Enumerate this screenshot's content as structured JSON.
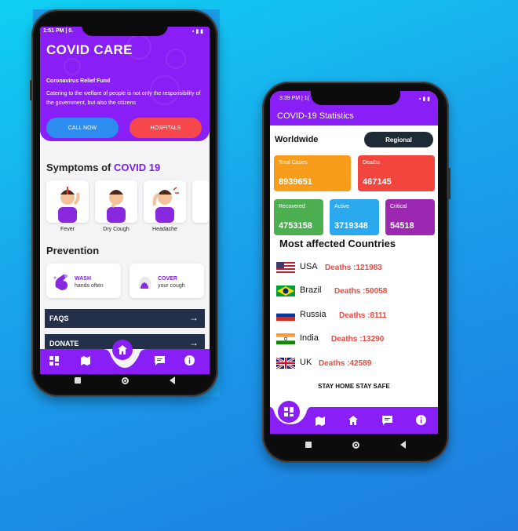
{
  "left_phone": {
    "status": {
      "time": "1:51 PM | 0."
    },
    "hero": {
      "title": "COVID CARE",
      "subtitle": "Coronavirus Relief Fund",
      "description": "Catering to the welfare of people is not only the responsibility of the government, but also the citizens"
    },
    "buttons": {
      "call": "CALL NOW",
      "hospitals": "HOSPITALS"
    },
    "symptoms": {
      "title_prefix": "Symptoms of ",
      "title_accent": "COVID 19",
      "items": [
        "Fever",
        "Dry Cough",
        "Headache"
      ]
    },
    "prevention": {
      "title": "Prevention",
      "items": [
        {
          "action": "WASH",
          "detail": "hands often"
        },
        {
          "action": "COVER",
          "detail": "your cough"
        }
      ]
    },
    "rows": {
      "faqs": "FAQS",
      "donate": "DONATE",
      "arrow": "→"
    },
    "bottom_nav": [
      "dashboard-icon",
      "map-icon",
      "home-icon",
      "chat-icon",
      "info-icon"
    ]
  },
  "right_phone": {
    "status": {
      "time": "3:39 PM | 1("
    },
    "header": {
      "title": "COVID-19 Statistics"
    },
    "worldwide": {
      "label": "Worldwide",
      "regional_button": "Regional"
    },
    "stats": [
      {
        "label": "Total Cases",
        "value": "8939651",
        "color": "#f89c1c"
      },
      {
        "label": "Deaths",
        "value": "467145",
        "color": "#f2453d"
      },
      {
        "label": "Recovered",
        "value": "4753158",
        "color": "#4caf50"
      },
      {
        "label": "Active",
        "value": "3719348",
        "color": "#2aa9ee"
      },
      {
        "label": "Critical",
        "value": "54518",
        "color": "#9c27b0"
      }
    ],
    "most_affected": {
      "title": "Most affected Countries",
      "countries": [
        {
          "name": "USA",
          "deaths": "Deaths :121983",
          "flag": "usa-flag-icon"
        },
        {
          "name": "Brazil",
          "deaths": "Deaths :50058",
          "flag": "brazil-flag-icon"
        },
        {
          "name": "Russia",
          "deaths": "Deaths :8111",
          "flag": "russia-flag-icon"
        },
        {
          "name": "India",
          "deaths": "Deaths :13290",
          "flag": "india-flag-icon"
        },
        {
          "name": "UK",
          "deaths": "Deaths :42589",
          "flag": "uk-flag-icon"
        }
      ]
    },
    "footer": "STAY HOME STAY SAFE",
    "bottom_nav": [
      "dashboard-icon",
      "map-icon",
      "home-icon",
      "chat-icon",
      "info-icon"
    ]
  },
  "colors": {
    "primary": "#8a1ef6",
    "dark_row": "#24304a",
    "deaths_text": "#e84a3f"
  }
}
